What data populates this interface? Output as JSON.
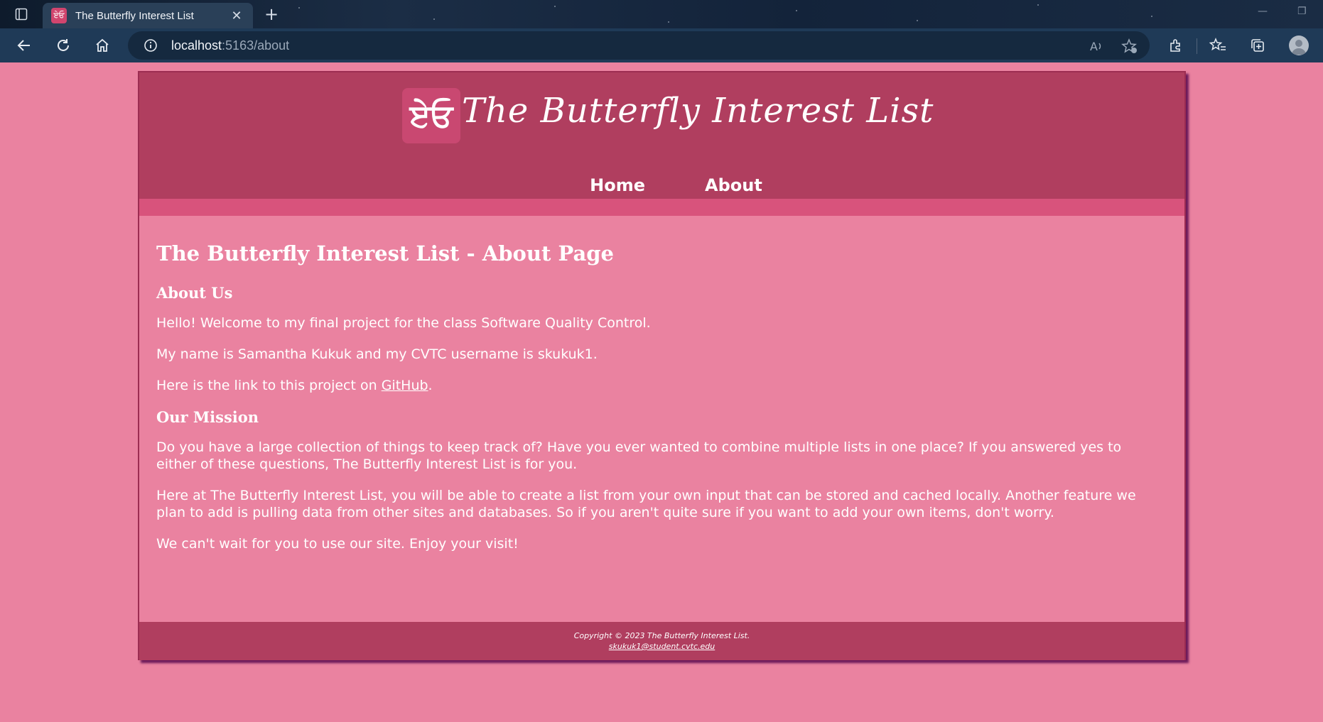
{
  "browser": {
    "tab_title": "The Butterfly Interest List",
    "favicon_glyph": "ਏਓ",
    "url_host": "localhost",
    "url_rest": ":5163/about",
    "icons": {
      "sidebar": "tab-actions-icon",
      "back": "back-arrow-icon",
      "reload": "reload-icon",
      "home": "home-icon",
      "info": "site-info-icon",
      "read_aloud": "read-aloud-icon",
      "favorite": "add-favorite-icon",
      "extensions": "extensions-icon",
      "favorites": "favorites-icon",
      "collections": "collections-icon",
      "profile": "profile-icon"
    }
  },
  "site": {
    "logo_glyph": "ਏਓ",
    "title": "The Butterfly Interest List",
    "nav": [
      "Home",
      "About"
    ]
  },
  "content": {
    "page_heading": "The Butterfly Interest List - About Page",
    "about_heading": "About Us",
    "p1": "Hello! Welcome to my final project for the class Software Quality Control.",
    "p2": "My name is Samantha Kukuk and my CVTC username is skukuk1.",
    "p3_before": "Here is the link to this project on ",
    "p3_link": "GitHub",
    "p3_after": ".",
    "mission_heading": "Our Mission",
    "p4": "Do you have a large collection of things to keep track of? Have you ever wanted to combine multiple lists in one place? If you answered yes to either of these questions, The Butterfly Interest List is for you.",
    "p5": "Here at The Butterfly Interest List, you will be able to create a list from your own input that can be stored and cached locally. Another feature we plan to add is pulling data from other sites and databases. So if you aren't quite sure if you want to add your own items, don't worry.",
    "p6": "We can't wait for you to use our site. Enjoy your visit!"
  },
  "footer": {
    "copyright": "Copyright © 2023 The Butterfly Interest List.",
    "email": "skukuk1@student.cvtc.edu"
  },
  "colors": {
    "page_bg": "#ea82a0",
    "header_bg": "#b03e5f",
    "header_bar": "#d8537c",
    "border": "#9c2d52",
    "shadow": "#6c1a5a"
  }
}
